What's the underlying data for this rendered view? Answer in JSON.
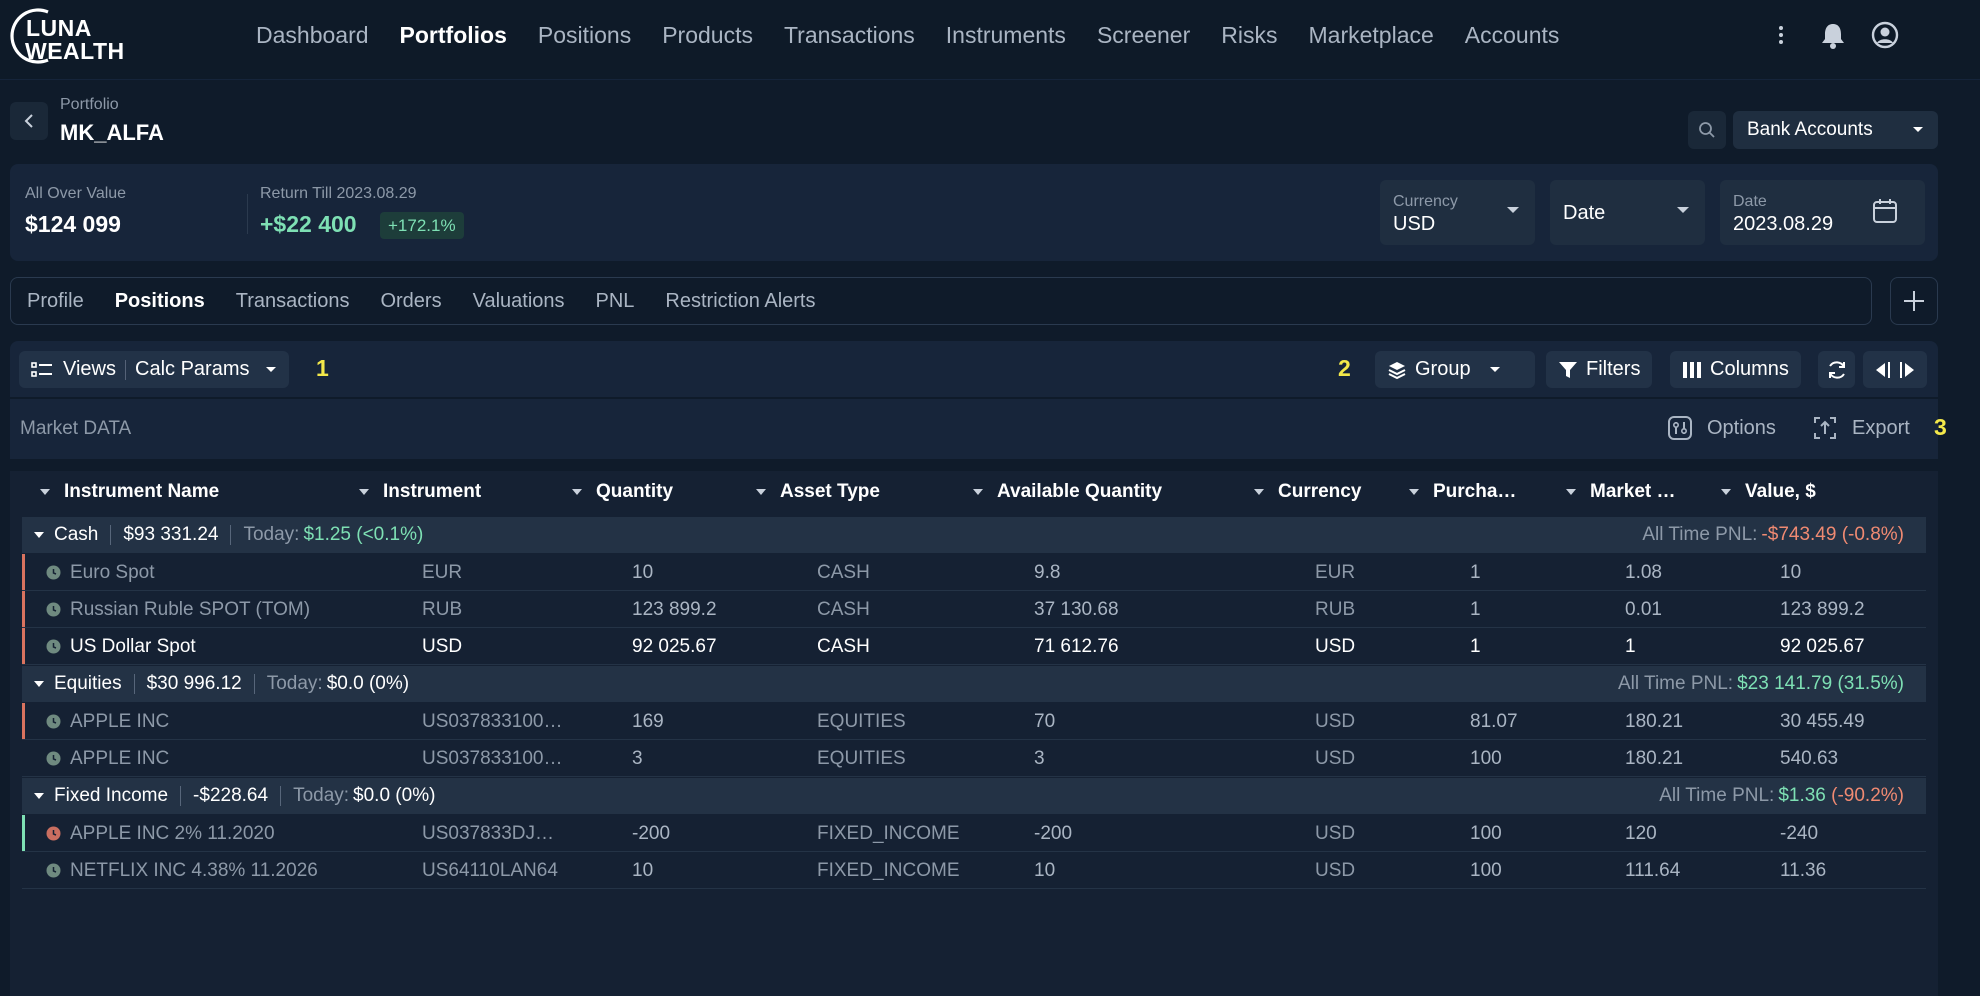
{
  "app": {
    "logo_line1": "LUNA",
    "logo_line2": "WEALTH",
    "nav": [
      "Dashboard",
      "Portfolios",
      "Positions",
      "Products",
      "Transactions",
      "Instruments",
      "Screener",
      "Risks",
      "Marketplace",
      "Accounts"
    ],
    "nav_active": "Portfolios",
    "icons": [
      "more-vertical-icon",
      "bell-icon",
      "user-circle-icon"
    ]
  },
  "header": {
    "breadcrumb": "Portfolio",
    "title": "MK_ALFA",
    "account_select": "Bank Accounts"
  },
  "summary": {
    "overall_label": "All Over Value",
    "overall_value": "$124 099",
    "return_label": "Return Till 2023.08.29",
    "return_value": "+$22 400",
    "return_pct": "+172.1%",
    "currency_label": "Currency",
    "currency_value": "USD",
    "date_mode": "Date",
    "date_label": "Date",
    "date_value": "2023.08.29"
  },
  "tabs": [
    "Profile",
    "Positions",
    "Transactions",
    "Orders",
    "Valuations",
    "PNL",
    "Restriction Alerts"
  ],
  "tabs_active": "Positions",
  "toolbar": {
    "views_label": "Views",
    "calc_label": "Calc Params",
    "marker1": "1",
    "marker2": "2",
    "marker3": "3",
    "group_label": "Group",
    "filters_label": "Filters",
    "columns_label": "Columns",
    "market_label": "Market DATA",
    "options_label": "Options",
    "export_label": "Export"
  },
  "table": {
    "columns": [
      "Instrument Name",
      "Instrument",
      "Quantity",
      "Asset Type",
      "Available Quantity",
      "Currency",
      "Purcha…",
      "Market …",
      "Value, $"
    ],
    "groups": [
      {
        "name": "Cash",
        "total": "$93 331.24",
        "today_label": "Today:",
        "today": "$1.25 (<0.1%)",
        "pnl_label": "All Time PNL:",
        "pnl": "-$743.49 (-0.8%)",
        "pnl_tone": "negative",
        "rows": [
          {
            "cells": [
              "Euro Spot",
              "EUR",
              "10",
              "CASH",
              "9.8",
              "EUR",
              "1",
              "1.08",
              "10"
            ],
            "bar": "#d9735f",
            "status": "ok",
            "bright": false
          },
          {
            "cells": [
              "Russian Ruble SPOT (TOM)",
              "RUB",
              "123 899.2",
              "CASH",
              "37 130.68",
              "RUB",
              "1",
              "0.01",
              "123 899.2"
            ],
            "bar": "#d9735f",
            "status": "ok",
            "bright": false
          },
          {
            "cells": [
              "US Dollar Spot",
              "USD",
              "92 025.67",
              "CASH",
              "71 612.76",
              "USD",
              "1",
              "1",
              "92 025.67"
            ],
            "bar": "#d9735f",
            "status": "ok",
            "bright": true
          }
        ]
      },
      {
        "name": "Equities",
        "total": "$30 996.12",
        "today_label": "Today:",
        "today": "$0.0 (0%)",
        "pnl_label": "All Time PNL:",
        "pnl": "$23 141.79 (31.5%)",
        "pnl_tone": "positive",
        "rows": [
          {
            "cells": [
              "APPLE INC",
              "US037833100…",
              "169",
              "EQUITIES",
              "70",
              "USD",
              "81.07",
              "180.21",
              "30 455.49"
            ],
            "bar": "#d9735f",
            "status": "ok",
            "bright": false
          },
          {
            "cells": [
              "APPLE INC",
              "US037833100…",
              "3",
              "EQUITIES",
              "3",
              "USD",
              "100",
              "180.21",
              "540.63"
            ],
            "bar": "transparent",
            "status": "ok",
            "bright": false
          }
        ]
      },
      {
        "name": "Fixed Income",
        "total": "-$228.64",
        "today_label": "Today:",
        "today": "$0.0 (0%)",
        "pnl_label": "All Time PNL:",
        "pnl": "$1.36",
        "pnl_extra": "(-90.2%)",
        "pnl_tone": "mixed",
        "rows": [
          {
            "cells": [
              "APPLE INC 2% 11.2020",
              "US037833DJ…",
              "-200",
              "FIXED_INCOME",
              "-200",
              "USD",
              "100",
              "120",
              "-240"
            ],
            "bar": "#7ee0b4",
            "status": "warn",
            "bright": false
          },
          {
            "cells": [
              "NETFLIX INC 4.38% 11.2026",
              "US64110LAN64",
              "10",
              "FIXED_INCOME",
              "10",
              "USD",
              "100",
              "111.64",
              "11.36"
            ],
            "bar": "transparent",
            "status": "ok",
            "bright": false
          }
        ]
      }
    ]
  },
  "colors": {
    "background": "#0f1b2a",
    "panel": "#17253a",
    "positive": "#7ee0b4",
    "negative": "#f08a72",
    "marker": "#f3e84a"
  }
}
